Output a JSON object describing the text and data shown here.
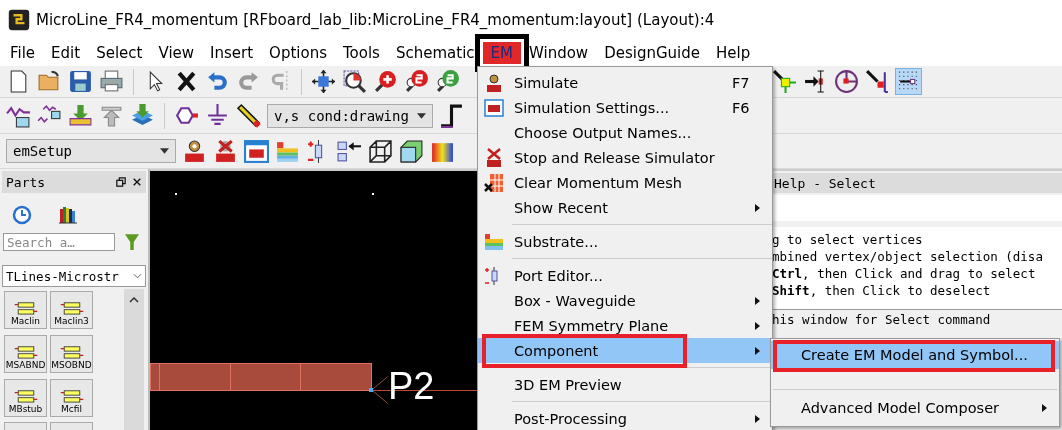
{
  "window": {
    "title": "MicroLine_FR4_momentum [RFboard_lab_lib:MicroLine_FR4_momentum:layout] (Layout):4"
  },
  "menubar": [
    {
      "label": "File",
      "selected": false,
      "annotated": false
    },
    {
      "label": "Edit",
      "selected": false,
      "annotated": false
    },
    {
      "label": "Select",
      "selected": false,
      "annotated": false
    },
    {
      "label": "View",
      "selected": false,
      "annotated": false
    },
    {
      "label": "Insert",
      "selected": false,
      "annotated": false
    },
    {
      "label": "Options",
      "selected": false,
      "annotated": false
    },
    {
      "label": "Tools",
      "selected": false,
      "annotated": false
    },
    {
      "label": "Schematic",
      "selected": false,
      "annotated": false
    },
    {
      "label": "EM",
      "selected": true,
      "annotated": true
    },
    {
      "label": "Window",
      "selected": false,
      "annotated": false
    },
    {
      "label": "DesignGuide",
      "selected": false,
      "annotated": false
    },
    {
      "label": "Help",
      "selected": false,
      "annotated": false
    }
  ],
  "toolbar": {
    "layer_select": "v,s cond:drawing",
    "setup_select": "emSetup"
  },
  "parts_panel": {
    "title": "Parts",
    "search": {
      "placeholder": "Search a…"
    },
    "library": "TLines-Microstr",
    "parts": [
      {
        "label": "Maclin"
      },
      {
        "label": "Maclin3"
      },
      {
        "label": "MSABND"
      },
      {
        "label": "MSOBND"
      },
      {
        "label": "MBstub"
      },
      {
        "label": "Mcfil"
      }
    ]
  },
  "layout": {
    "port_label": "P2"
  },
  "help_panel": {
    "title": "Help - Select",
    "lines": [
      "g to select vertices",
      "mbined vertex/object selection (disa",
      "**Ctrl**, then Click and drag to select",
      "**Shift**, then Click to deselect"
    ],
    "footer": "his window for Select command"
  },
  "em_menu": {
    "items": [
      {
        "kind": "item",
        "label": "Simulate",
        "shortcut": "F7",
        "submenu": false,
        "selected": false,
        "annotated": false
      },
      {
        "kind": "item",
        "label": "Simulation Settings...",
        "shortcut": "F6",
        "submenu": false,
        "selected": false,
        "annotated": false
      },
      {
        "kind": "item",
        "label": "Choose Output Names...",
        "submenu": false,
        "selected": false,
        "annotated": false
      },
      {
        "kind": "item",
        "label": "Stop and Release Simulator",
        "submenu": false,
        "selected": false,
        "annotated": false
      },
      {
        "kind": "item",
        "label": "Clear Momentum Mesh",
        "submenu": false,
        "selected": false,
        "annotated": false
      },
      {
        "kind": "item",
        "label": "Show Recent",
        "submenu": true,
        "selected": false,
        "annotated": false
      },
      {
        "kind": "separator"
      },
      {
        "kind": "item",
        "label": "Substrate...",
        "submenu": false,
        "selected": false,
        "annotated": false
      },
      {
        "kind": "separator"
      },
      {
        "kind": "item",
        "label": "Port Editor...",
        "submenu": false,
        "selected": false,
        "annotated": false
      },
      {
        "kind": "item",
        "label": "Box - Waveguide",
        "submenu": true,
        "selected": false,
        "annotated": false
      },
      {
        "kind": "item",
        "label": "FEM Symmetry Plane",
        "submenu": true,
        "selected": false,
        "annotated": false
      },
      {
        "kind": "item",
        "label": "Component",
        "submenu": true,
        "selected": true,
        "annotated": true
      },
      {
        "kind": "separator"
      },
      {
        "kind": "item",
        "label": "3D EM Preview",
        "submenu": false,
        "selected": false,
        "annotated": false
      },
      {
        "kind": "separator"
      },
      {
        "kind": "item",
        "label": "Post-Processing",
        "submenu": true,
        "selected": false,
        "annotated": false
      }
    ]
  },
  "component_submenu": {
    "items": [
      {
        "kind": "item",
        "label": "Create EM Model and Symbol...",
        "submenu": false,
        "selected": true,
        "annotated": true
      },
      {
        "kind": "separator"
      },
      {
        "kind": "item",
        "label": "Advanced Model Composer",
        "submenu": true,
        "selected": false,
        "annotated": false
      }
    ]
  }
}
